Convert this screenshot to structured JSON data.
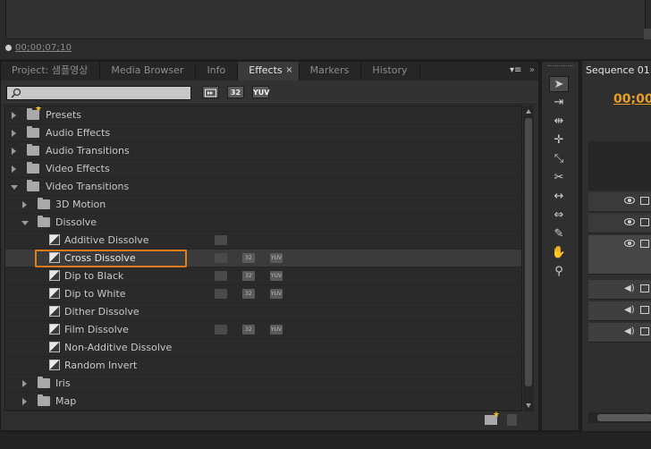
{
  "monitor": {
    "timecode": "00;00;07;10"
  },
  "effects_panel": {
    "tabs": [
      {
        "label": "Project: 샘플영상",
        "active": false
      },
      {
        "label": "Media Browser",
        "active": false
      },
      {
        "label": "Info",
        "active": false
      },
      {
        "label": "Effects",
        "active": true
      },
      {
        "label": "Markers",
        "active": false
      },
      {
        "label": "History",
        "active": false
      }
    ],
    "close_glyph": "×",
    "search": {
      "value": "",
      "placeholder": ""
    },
    "filters": [
      {
        "label": "",
        "icon": "accelerated-effects-icon"
      },
      {
        "label": "32",
        "icon": "32-bit-icon"
      },
      {
        "label": "YUV",
        "icon": "yuv-icon"
      }
    ],
    "tree": [
      {
        "type": "folder",
        "label": "Presets",
        "expanded": false,
        "level": 0,
        "icon": "presets-folder-icon"
      },
      {
        "type": "folder",
        "label": "Audio Effects",
        "expanded": false,
        "level": 0
      },
      {
        "type": "folder",
        "label": "Audio Transitions",
        "expanded": false,
        "level": 0
      },
      {
        "type": "folder",
        "label": "Video Effects",
        "expanded": false,
        "level": 0
      },
      {
        "type": "folder",
        "label": "Video Transitions",
        "expanded": true,
        "level": 0
      },
      {
        "type": "folder",
        "label": "3D Motion",
        "expanded": false,
        "level": 1
      },
      {
        "type": "folder",
        "label": "Dissolve",
        "expanded": true,
        "level": 1
      },
      {
        "type": "effect",
        "label": "Additive Dissolve",
        "level": 2,
        "badges": [
          "accel"
        ]
      },
      {
        "type": "effect",
        "label": "Cross Dissolve",
        "level": 2,
        "badges": [
          "accel",
          "32",
          "YUV"
        ],
        "selected": true
      },
      {
        "type": "effect",
        "label": "Dip to Black",
        "level": 2,
        "badges": [
          "accel",
          "32",
          "YUV"
        ]
      },
      {
        "type": "effect",
        "label": "Dip to White",
        "level": 2,
        "badges": [
          "accel",
          "32",
          "YUV"
        ]
      },
      {
        "type": "effect",
        "label": "Dither Dissolve",
        "level": 2,
        "badges": []
      },
      {
        "type": "effect",
        "label": "Film Dissolve",
        "level": 2,
        "badges": [
          "accel",
          "32",
          "YUV"
        ]
      },
      {
        "type": "effect",
        "label": "Non-Additive Dissolve",
        "level": 2,
        "badges": []
      },
      {
        "type": "effect",
        "label": "Random Invert",
        "level": 2,
        "badges": []
      },
      {
        "type": "folder",
        "label": "Iris",
        "expanded": false,
        "level": 1
      },
      {
        "type": "folder",
        "label": "Map",
        "expanded": false,
        "level": 1
      }
    ]
  },
  "tools": [
    {
      "name": "selection-tool-icon",
      "glyph": "➤",
      "active": true
    },
    {
      "name": "track-select-tool-icon",
      "glyph": "⇥",
      "active": false
    },
    {
      "name": "ripple-edit-tool-icon",
      "glyph": "⇹",
      "active": false
    },
    {
      "name": "rolling-edit-tool-icon",
      "glyph": "✛",
      "active": false
    },
    {
      "name": "rate-stretch-tool-icon",
      "glyph": "⤡",
      "active": false
    },
    {
      "name": "razor-tool-icon",
      "glyph": "✂",
      "active": false
    },
    {
      "name": "slip-tool-icon",
      "glyph": "↔",
      "active": false
    },
    {
      "name": "slide-tool-icon",
      "glyph": "⇔",
      "active": false
    },
    {
      "name": "pen-tool-icon",
      "glyph": "✎",
      "active": false
    },
    {
      "name": "hand-tool-icon",
      "glyph": "✋",
      "active": false
    },
    {
      "name": "zoom-tool-icon",
      "glyph": "⚲",
      "active": false
    }
  ],
  "sequence": {
    "tab_label": "Sequence 01",
    "timecode": "00;00;"
  },
  "colors": {
    "accent_orange": "#e07b1e",
    "timecode_gold": "#e8a020",
    "panel_bg": "#2f2f2f"
  }
}
